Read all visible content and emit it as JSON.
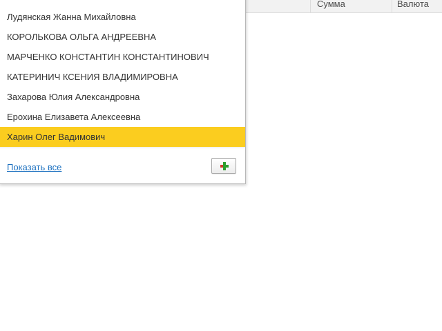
{
  "table_header": {
    "columns": [
      {
        "label": "Сумма"
      },
      {
        "label": "Валюта"
      }
    ]
  },
  "dropdown": {
    "items": [
      {
        "label": "Лудянская Жанна Михайловна",
        "selected": false
      },
      {
        "label": "КОРОЛЬКОВА ОЛЬГА АНДРЕЕВНА",
        "selected": false
      },
      {
        "label": "МАРЧЕНКО КОНСТАНТИН КОНСТАНТИНОВИЧ",
        "selected": false
      },
      {
        "label": "КАТЕРИНИЧ КСЕНИЯ ВЛАДИМИРОВНА",
        "selected": false
      },
      {
        "label": "Захарова Юлия Александровна",
        "selected": false
      },
      {
        "label": "Ерохина Елизавета Алексеевна",
        "selected": false
      },
      {
        "label": "Харин Олег Вадимович",
        "selected": true
      }
    ],
    "show_all_label": "Показать все",
    "add_button_icon": "plus-icon",
    "colors": {
      "selected_bg": "#fbcd1f",
      "link": "#1a6fbf",
      "plus_green": "#2e9e2e",
      "plus_red": "#d23b2b"
    }
  }
}
